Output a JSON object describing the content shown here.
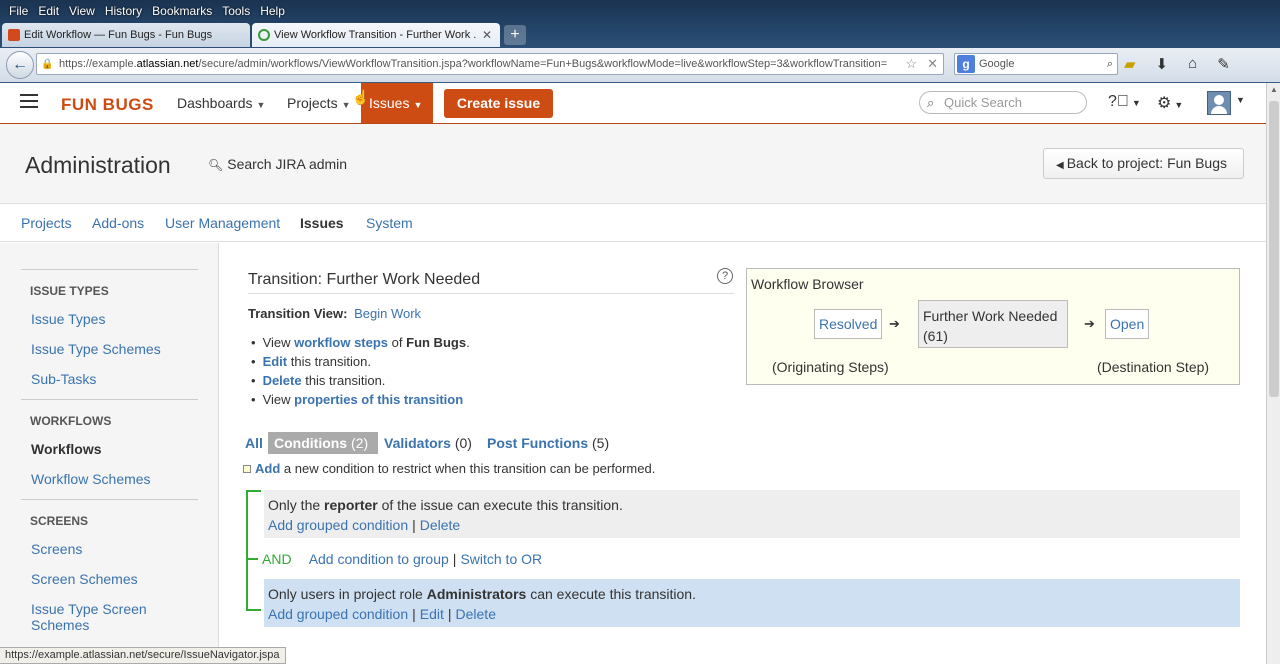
{
  "browser": {
    "menu": [
      "File",
      "Edit",
      "View",
      "History",
      "Bookmarks",
      "Tools",
      "Help"
    ],
    "tabs": [
      {
        "title": "Edit Workflow — Fun Bugs - Fun Bugs"
      },
      {
        "title": "View Workflow Transition - Further Work ..."
      }
    ],
    "url_prefix": "https://example.",
    "url_host": "atlassian.net",
    "url_rest": "/secure/admin/workflows/ViewWorkflowTransition.jspa?workflowName=Fun+Bugs&workflowMode=live&workflowStep=3&workflowTransition=",
    "search_engine": "Google",
    "status_url": "https://example.atlassian.net/secure/IssueNavigator.jspa"
  },
  "header": {
    "logo": "FUN BUGS",
    "nav": {
      "dashboards": "Dashboards",
      "projects": "Projects",
      "issues": "Issues"
    },
    "create": "Create issue",
    "quick_search_placeholder": "Quick Search",
    "accent_color": "#cc4c13"
  },
  "admin": {
    "title": "Administration",
    "search": "Search JIRA admin",
    "back": "Back to project: Fun Bugs",
    "tabs": [
      "Projects",
      "Add-ons",
      "User Management",
      "Issues",
      "System"
    ],
    "active_tab": "Issues"
  },
  "sidebar": {
    "sections": [
      {
        "title": "ISSUE TYPES",
        "items": [
          "Issue Types",
          "Issue Type Schemes",
          "Sub-Tasks"
        ]
      },
      {
        "title": "WORKFLOWS",
        "items": [
          "Workflows",
          "Workflow Schemes"
        ]
      },
      {
        "title": "SCREENS",
        "items": [
          "Screens",
          "Screen Schemes",
          "Issue Type Screen Schemes"
        ]
      }
    ],
    "active_item": "Workflows"
  },
  "transition": {
    "title": "Transition: Further Work Needed",
    "view_label": "Transition View:",
    "view_value": "Begin Work",
    "bullets": [
      {
        "pre": "View ",
        "link": "workflow steps",
        "mid": " of ",
        "strong": "Fun Bugs",
        "post": "."
      },
      {
        "pre": "",
        "link": "Edit",
        "post": " this transition."
      },
      {
        "pre": "",
        "link": "Delete",
        "post": " this transition."
      },
      {
        "pre": "View ",
        "link": "properties of this transition",
        "post": ""
      }
    ]
  },
  "workflow_browser": {
    "title": "Workflow Browser",
    "originating": "Resolved",
    "current_name": "Further Work Needed",
    "current_id": "(61)",
    "destination": "Open",
    "originating_label": "(Originating Steps)",
    "destination_label": "(Destination Step)"
  },
  "condition_tabs": {
    "all": "All",
    "conditions": {
      "label": "Conditions",
      "count": "(2)"
    },
    "validators": {
      "label": "Validators",
      "count": "(0)"
    },
    "post_functions": {
      "label": "Post Functions",
      "count": "(5)"
    }
  },
  "add_condition": {
    "link": "Add",
    "text": " a new condition to restrict when this transition can be performed."
  },
  "conditions": [
    {
      "pre": "Only the ",
      "strong": "reporter",
      "post": " of the issue can execute this transition.",
      "actions": [
        "Add grouped condition",
        "Delete"
      ]
    },
    {
      "pre": "Only users in project role ",
      "strong": "Administrators",
      "post": " can execute this transition.",
      "actions": [
        "Add grouped condition",
        "Edit",
        "Delete"
      ]
    }
  ],
  "group": {
    "operator": "AND",
    "add": "Add condition to group",
    "switch": "Switch to OR"
  }
}
